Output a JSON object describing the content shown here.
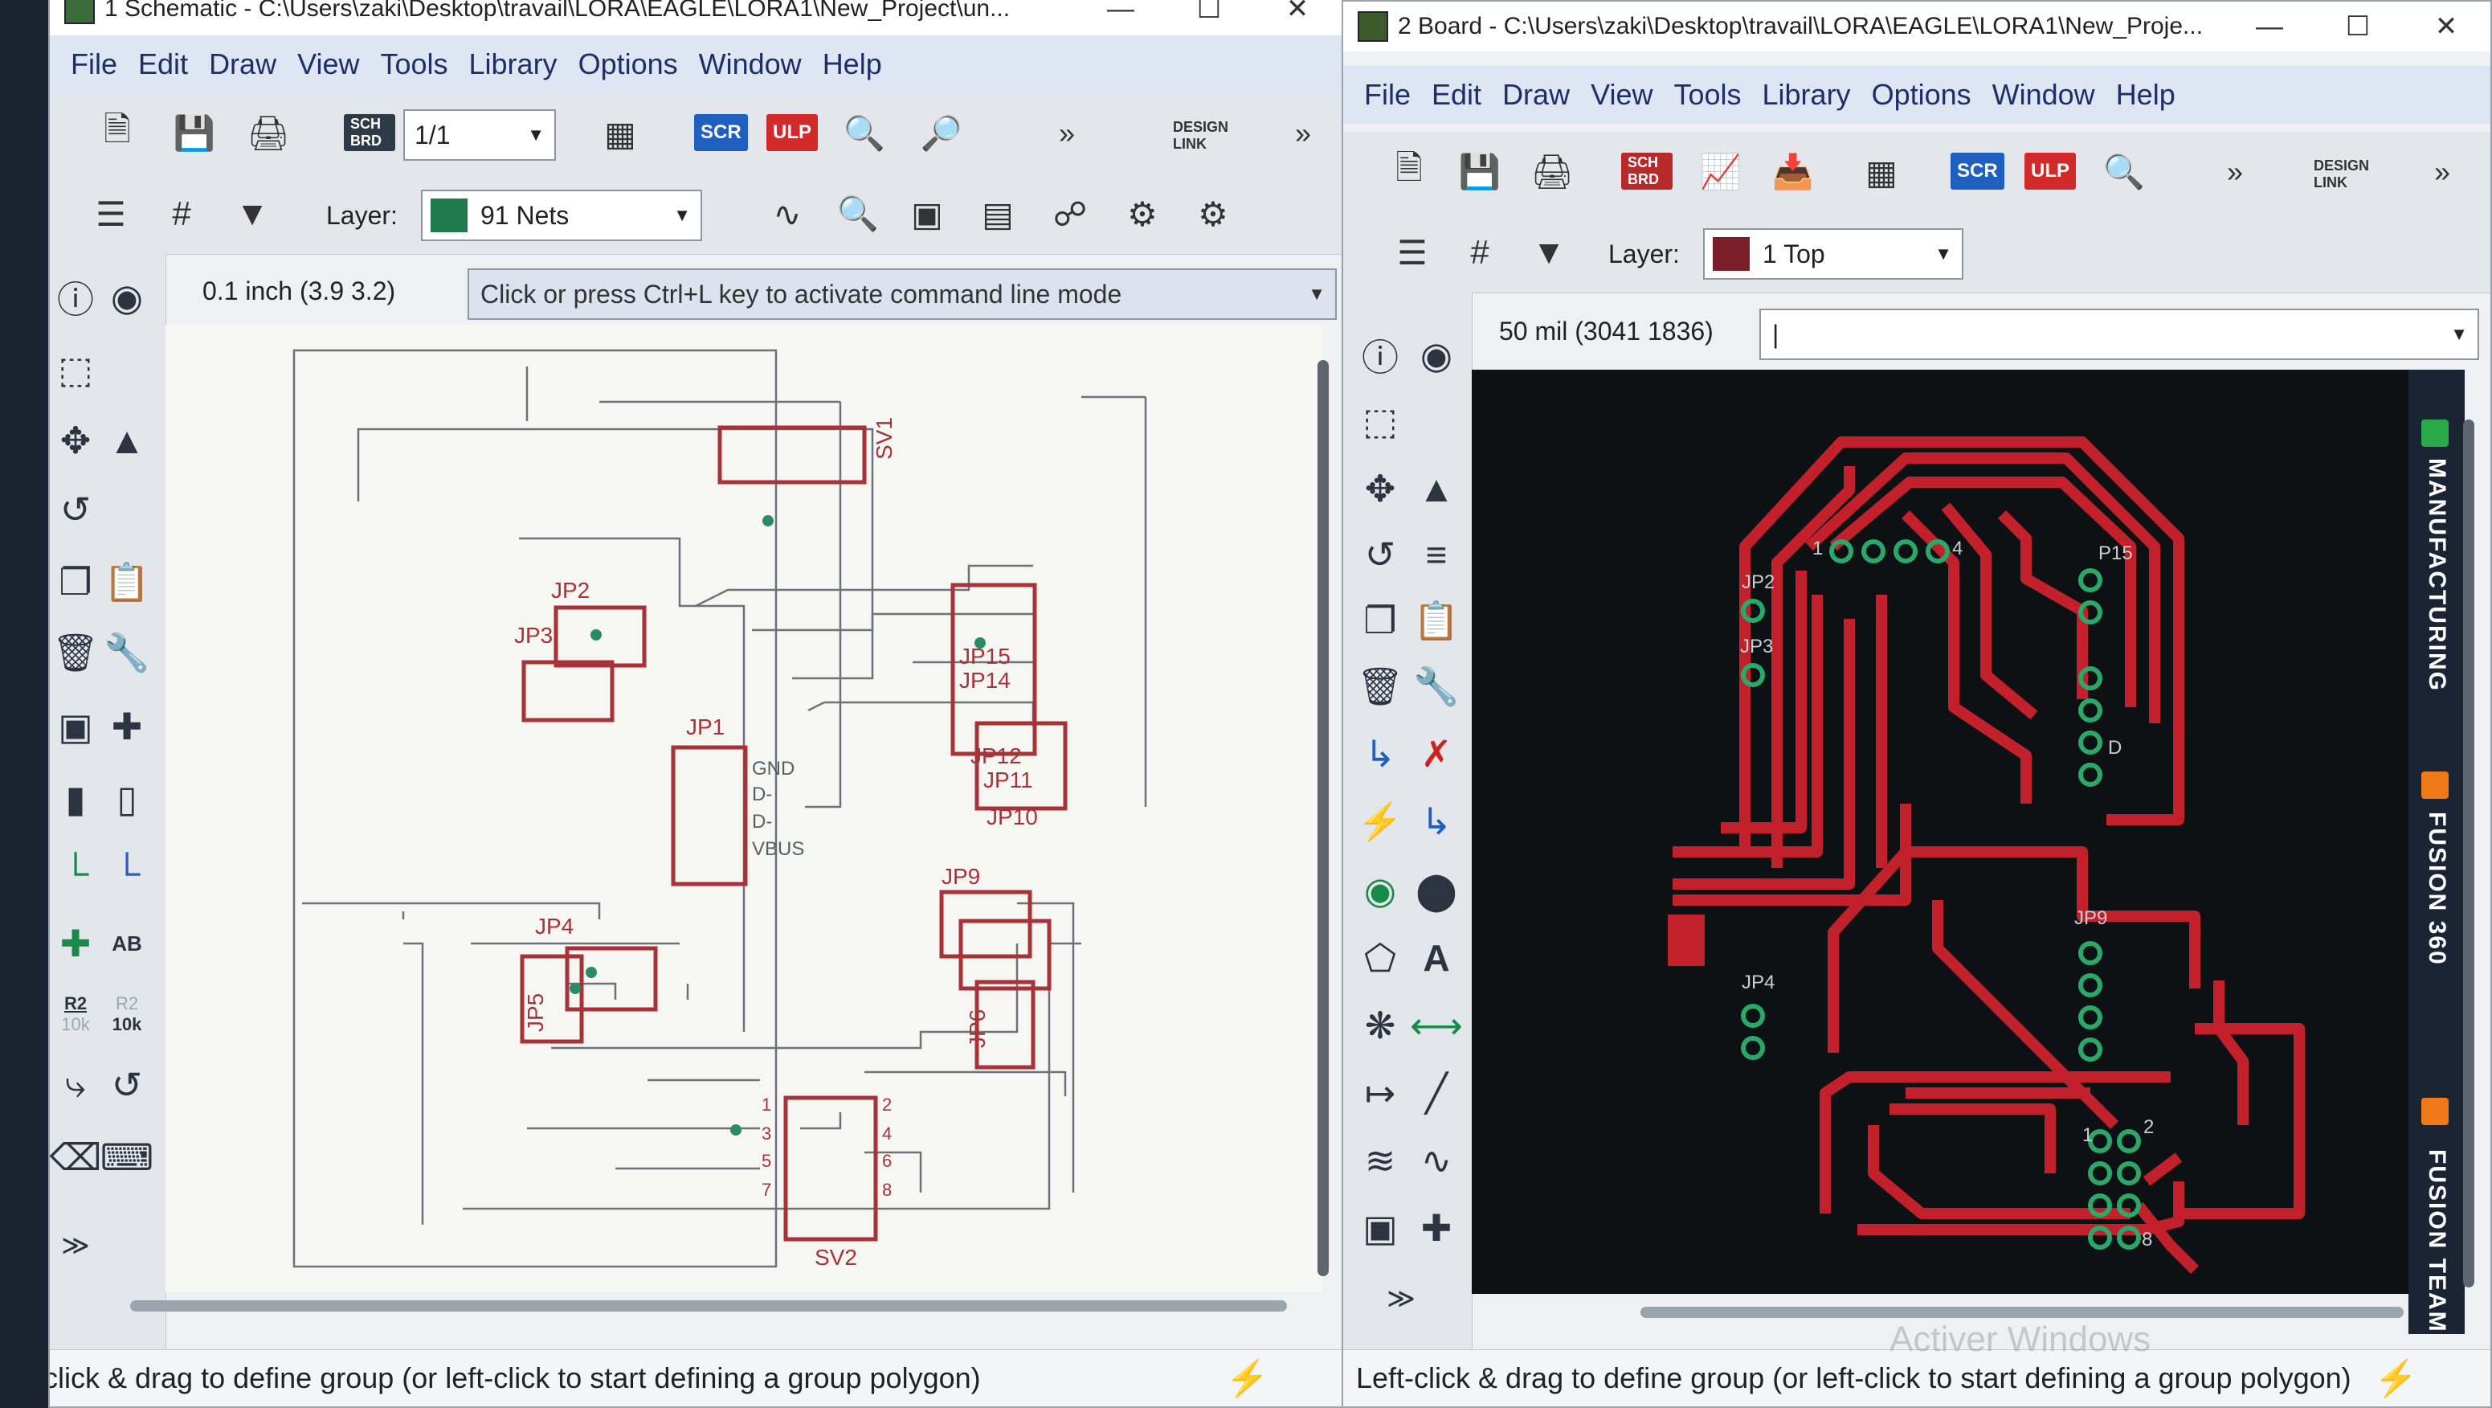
{
  "schematic": {
    "title": "1 Schematic - C:\\Users\\zaki\\Desktop\\travail\\LORA\\EAGLE\\LORA1\\New_Project\\un...",
    "menu": [
      "File",
      "Edit",
      "Draw",
      "View",
      "Tools",
      "Library",
      "Options",
      "Window",
      "Help"
    ],
    "toolbar": {
      "sheet": "1/1",
      "scr": "SCR",
      "ulp": "ULP",
      "schbrd": "SCH BRD",
      "design_link": "DESIGN LINK",
      "more": "»"
    },
    "layer_label": "Layer:",
    "layer": {
      "name": "91 Nets",
      "color": "#1e7a4a"
    },
    "coords": "0.1 inch (3.9 3.2)",
    "command": "Click or press Ctrl+L key to activate command line mode",
    "status": "eft-click & drag to define group (or left-click to start defining a group polygon)",
    "labels": {
      "sv1": "SV1",
      "jp2": "JP2",
      "jp3": "JP3",
      "jp1": "JP1",
      "gnd": "GND",
      "dminus": "D-",
      "dminus2": "D-",
      "vbus": "VBUS",
      "jp15": "JP15",
      "jp14": "JP14",
      "jp11": "JP11",
      "jp12": "JP12",
      "jp10": "JP10",
      "jp9": "JP9",
      "jp4": "JP4",
      "jp5": "JP5",
      "jp6": "JP6",
      "sv2": "SV2",
      "p1": "1",
      "p2": "2",
      "p3": "3",
      "p4": "4",
      "p5": "5",
      "p6": "6",
      "p7": "7",
      "p8": "8"
    },
    "sidebar_labels": {
      "r2": "R2",
      "r2v": "10k",
      "r2b": "R2",
      "r2bv": "10k",
      "ab": "AB"
    }
  },
  "board": {
    "title": "2 Board - C:\\Users\\zaki\\Desktop\\travail\\LORA\\EAGLE\\LORA1\\New_Proje...",
    "menu": [
      "File",
      "Edit",
      "Draw",
      "View",
      "Tools",
      "Library",
      "Options",
      "Window",
      "Help"
    ],
    "toolbar": {
      "scr": "SCR",
      "ulp": "ULP",
      "schbrd": "SCH BRD",
      "design_link": "DESIGN LINK",
      "more": "»"
    },
    "layer_label": "Layer:",
    "layer": {
      "name": "1 Top",
      "color": "#7a1e2a"
    },
    "coords": "50 mil (3041 1836)",
    "command": "|",
    "status": "Left-click & drag to define group (or left-click to start defining a group polygon)",
    "labels": {
      "p15": "P15",
      "jp2": "JP2",
      "jp3": "JP3",
      "jp9": "JP9",
      "jp4": "JP4",
      "one": "1",
      "four": "4",
      "d": "D",
      "eight": "8",
      "one_b": "1",
      "two_b": "2"
    },
    "side_tabs": [
      "MANUFACTURING",
      "FUSION 360",
      "FUSION TEAM"
    ]
  },
  "watermark": "Activer Windows",
  "colors": {
    "wire": "#a8323a",
    "junction": "#2a8a6a",
    "pcb_bg": "#0e1114",
    "trace": "#c2202a",
    "pad": "#2aa86a"
  }
}
